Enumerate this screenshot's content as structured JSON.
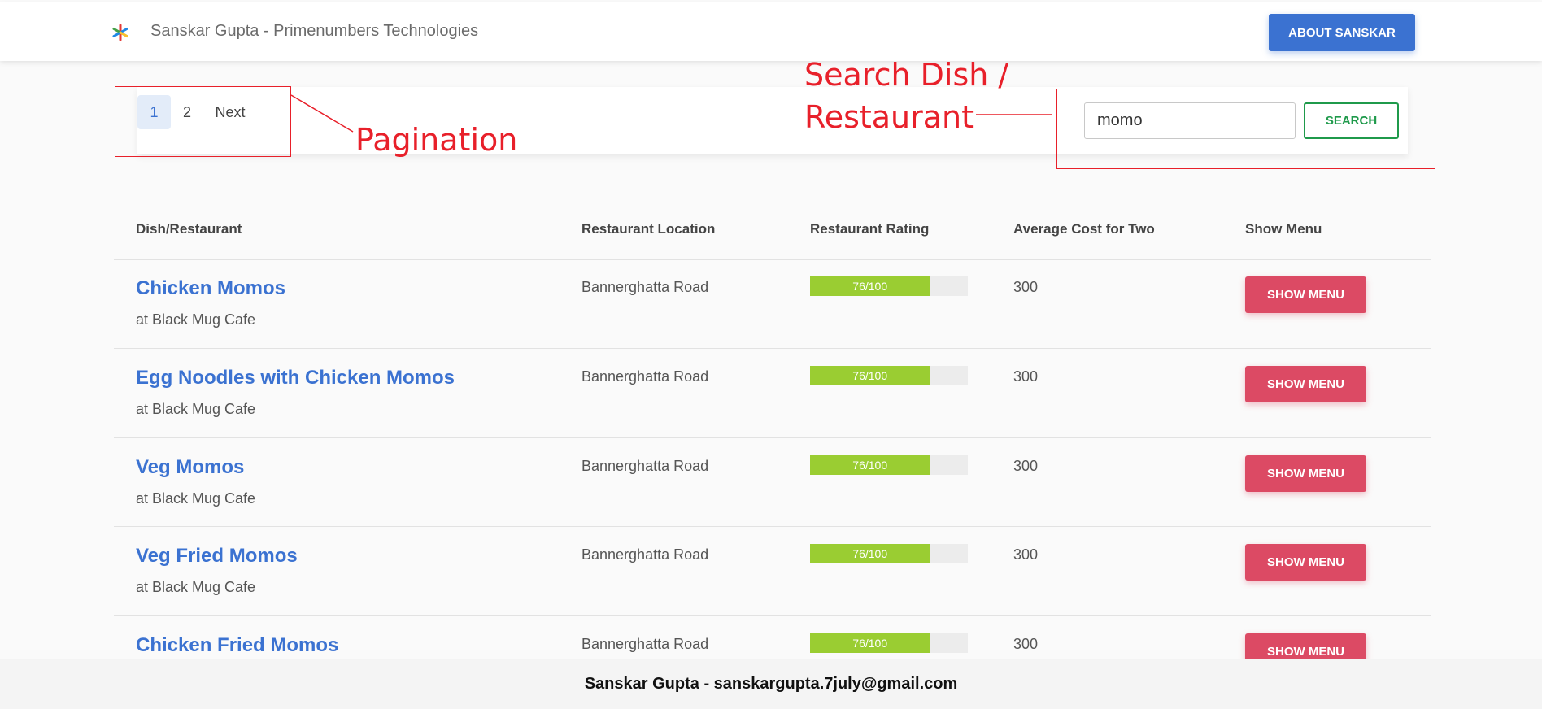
{
  "header": {
    "brand": "Sanskar Gupta - Primenumbers Technologies",
    "about_label": "ABOUT SANSKAR",
    "logo_icon": "multicolor-asterisk-icon",
    "accent": "#3b72d1"
  },
  "pagination": {
    "pages": [
      "1",
      "2"
    ],
    "active_page": "1",
    "next_label": "Next"
  },
  "search": {
    "value": "momo",
    "button_label": "SEARCH",
    "button_color": "#1f9a4b"
  },
  "annotations": {
    "pagination": "Pagination",
    "search_line1": "Search Dish /",
    "search_line2": "Restaurant",
    "color": "#e8202a"
  },
  "table": {
    "headers": [
      "Dish/Restaurant",
      "Restaurant Location",
      "Restaurant Rating",
      "Average Cost for Two",
      "Show Menu"
    ],
    "rows": [
      {
        "dish": "Chicken Momos",
        "restaurant": "at Black Mug Cafe",
        "location": "Bannerghatta Road",
        "rating": 76,
        "rating_label": "76/100",
        "cost": "300",
        "menu_label": "SHOW MENU"
      },
      {
        "dish": "Egg Noodles with Chicken Momos",
        "restaurant": "at Black Mug Cafe",
        "location": "Bannerghatta Road",
        "rating": 76,
        "rating_label": "76/100",
        "cost": "300",
        "menu_label": "SHOW MENU"
      },
      {
        "dish": "Veg Momos",
        "restaurant": "at Black Mug Cafe",
        "location": "Bannerghatta Road",
        "rating": 76,
        "rating_label": "76/100",
        "cost": "300",
        "menu_label": "SHOW MENU"
      },
      {
        "dish": "Veg Fried Momos",
        "restaurant": "at Black Mug Cafe",
        "location": "Bannerghatta Road",
        "rating": 76,
        "rating_label": "76/100",
        "cost": "300",
        "menu_label": "SHOW MENU"
      },
      {
        "dish": "Chicken Fried Momos",
        "restaurant": "",
        "location": "Bannerghatta Road",
        "rating": 76,
        "rating_label": "76/100",
        "cost": "300",
        "menu_label": "SHOW MENU"
      }
    ],
    "rating_color": "#9acd32",
    "menu_button_color": "#dc4a64"
  },
  "footer": {
    "text": "Sanskar Gupta - sanskargupta.7july@gmail.com"
  }
}
